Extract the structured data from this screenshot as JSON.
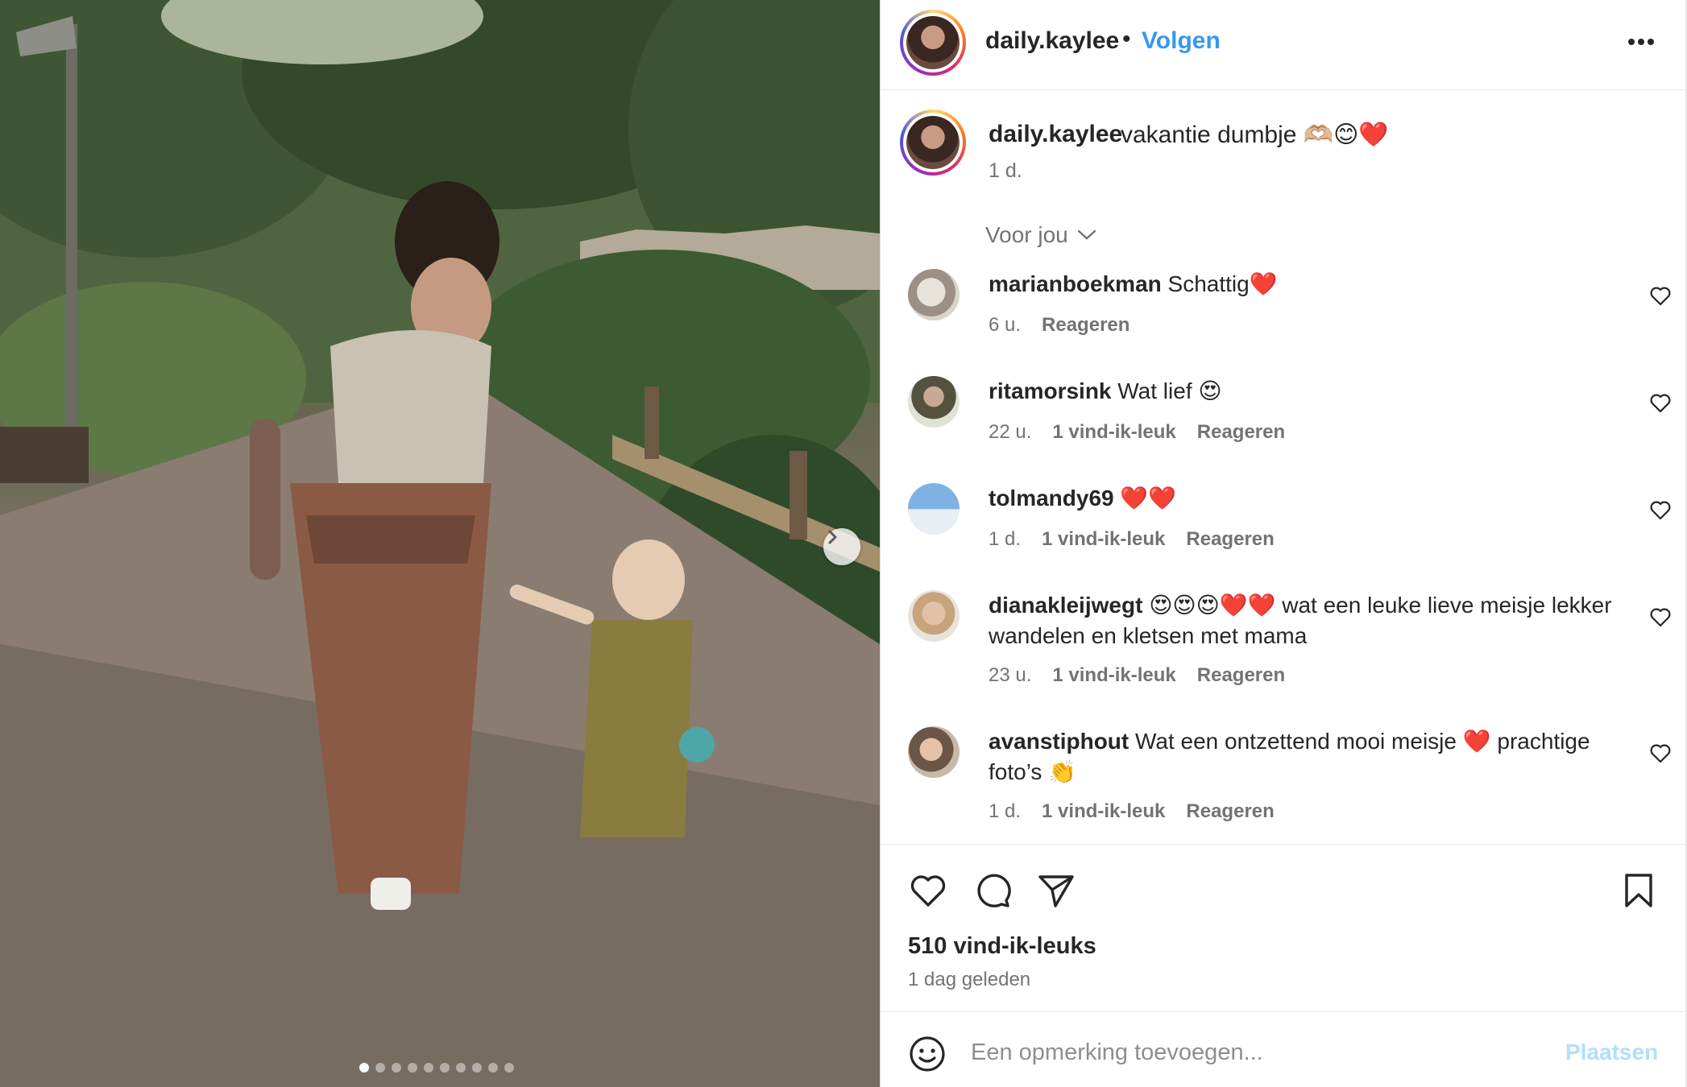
{
  "post": {
    "author": "daily.kaylee",
    "follow_label": "Volgen",
    "separator": "•",
    "caption_user": "daily.kaylee",
    "caption_text": "vakantie dumbje 🫶🏼😊❤️",
    "caption_time": "1 d."
  },
  "carousel": {
    "slide_count": 10,
    "active_index": 0
  },
  "filter": {
    "label": "Voor jou"
  },
  "comments": [
    {
      "user": "marianboekman",
      "text": "Schattig❤️",
      "time": "6 u.",
      "likes": "",
      "reply": "Reageren"
    },
    {
      "user": "ritamorsink",
      "text": "Wat lief 😍",
      "time": "22 u.",
      "likes": "1 vind-ik-leuk",
      "reply": "Reageren"
    },
    {
      "user": "tolmandy69",
      "text": "❤️❤️",
      "time": "1 d.",
      "likes": "1 vind-ik-leuk",
      "reply": "Reageren"
    },
    {
      "user": "dianakleijwegt",
      "text": "😍😍😍❤️❤️ wat een leuke lieve meisje lekker wandelen en kletsen met mama",
      "time": "23 u.",
      "likes": "1 vind-ik-leuk",
      "reply": "Reageren"
    },
    {
      "user": "avanstiphout",
      "text": "Wat een ontzettend mooi meisje ❤️ prachtige foto’s 👏",
      "time": "1 d.",
      "likes": "1 vind-ik-leuk",
      "reply": "Reageren"
    }
  ],
  "stats": {
    "likes": "510 vind-ik-leuks",
    "posted": "1 dag geleden"
  },
  "composer": {
    "placeholder": "Een opmerking toevoegen...",
    "post_label": "Plaatsen"
  },
  "colors": {
    "link_blue": "#3897f0",
    "post_disabled": "#b2dffc",
    "muted": "#737373"
  },
  "icons": [
    "more-icon",
    "chevron-down-icon",
    "heart-icon",
    "comment-icon",
    "share-icon",
    "bookmark-icon",
    "emoji-icon",
    "chevron-right-icon"
  ]
}
